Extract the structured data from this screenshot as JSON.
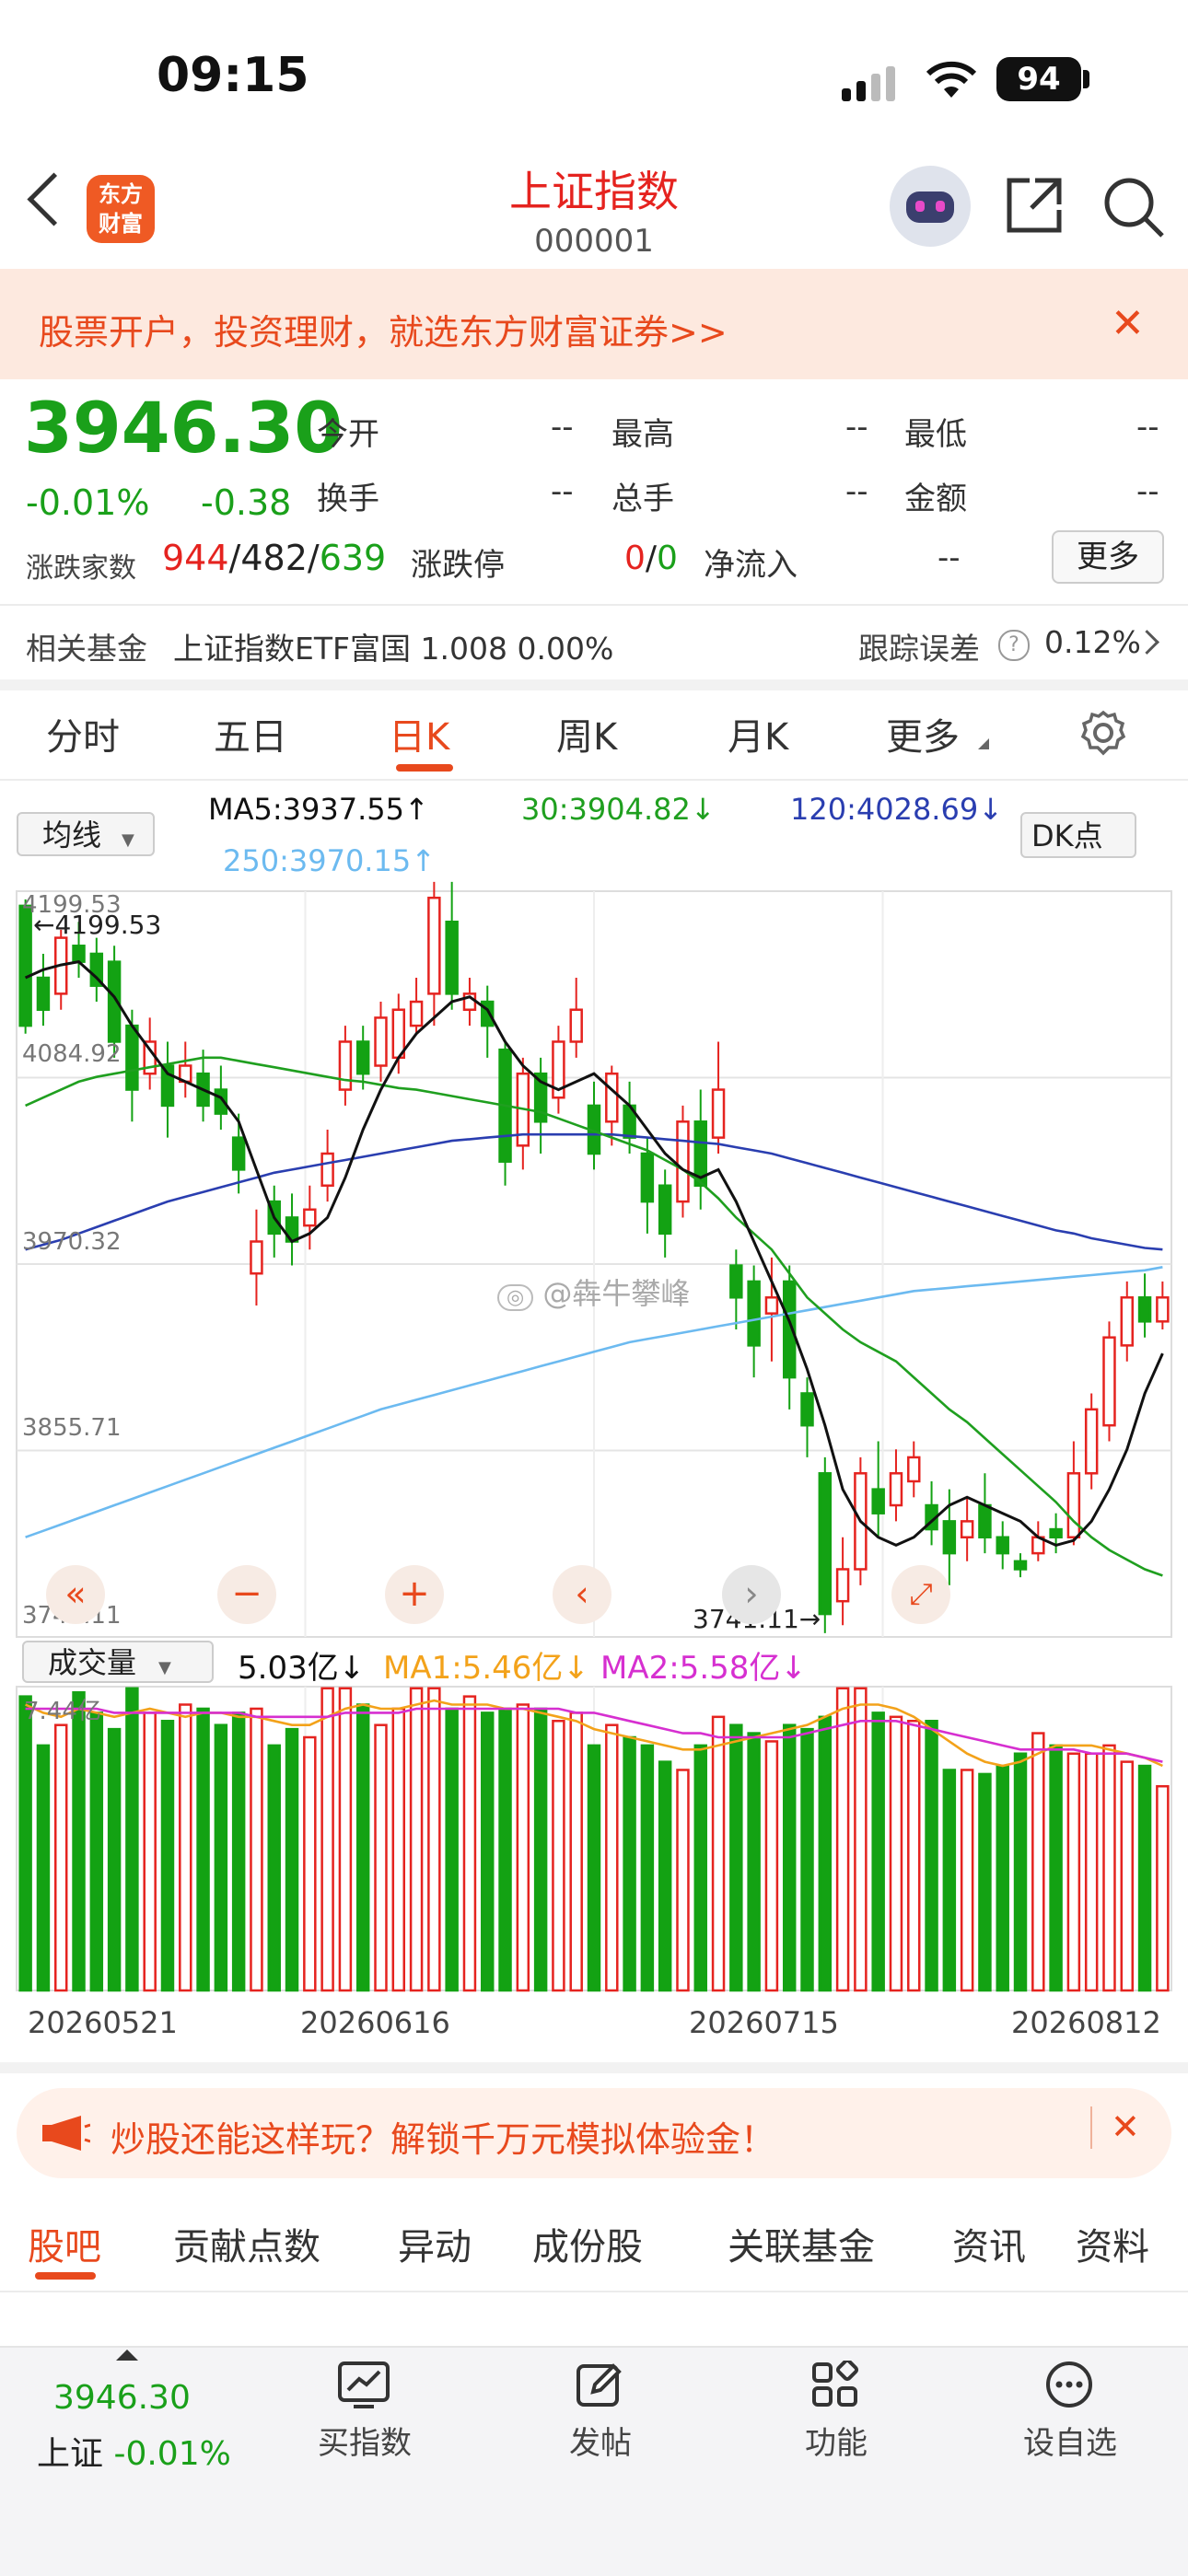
{
  "status_bar": {
    "time": "09:15",
    "battery": "94"
  },
  "header": {
    "title": "上证指数",
    "code": "000001",
    "logo_text_line1": "东方",
    "logo_text_line2": "财富"
  },
  "banner": {
    "text": "股票开户，投资理财，就选东方财富证券>>",
    "close": "✕"
  },
  "quote": {
    "price": "3946.30",
    "change_pct": "-0.01%",
    "change": "-0.38",
    "open_label": "今开",
    "open": "--",
    "high_label": "最高",
    "high": "--",
    "low_label": "最低",
    "low": "--",
    "turnover_label": "换手",
    "turnover": "--",
    "volume_label": "总手",
    "volume": "--",
    "amount_label": "金额",
    "amount": "--",
    "breadth_label": "涨跌家数",
    "breadth_up": "944",
    "breadth_flat": "482",
    "breadth_down": "639",
    "limit_label": "涨跌停",
    "limit_up": "0",
    "limit_down": "0",
    "inflow_label": "净流入",
    "inflow": "--",
    "more": "更多"
  },
  "fund": {
    "label": "相关基金",
    "name": "上证指数ETF富国",
    "price": "1.008",
    "pct": "0.00%",
    "error_label": "跟踪误差",
    "error": "0.12%"
  },
  "tabs": [
    "分时",
    "五日",
    "日K",
    "周K",
    "月K",
    "更多"
  ],
  "active_tab": "日K",
  "chart": {
    "ma_selector": "均线",
    "ma5": "MA5:3937.55↑",
    "ma30": "30:3904.82↓",
    "ma120": "120:4028.69↓",
    "ma250": "250:3970.15↑",
    "dk_button": "DK点",
    "y_labels": [
      "4199.53",
      "4084.92",
      "3970.32",
      "3855.71",
      "3741.11"
    ],
    "max_marker": "4199.53",
    "min_marker": "3741.11",
    "watermark": "@犇牛攀峰",
    "vol_selector": "成交量",
    "vol_value": "5.03亿↓",
    "vol_ma1": "MA1:5.46亿↓",
    "vol_ma2": "MA2:5.58亿↓",
    "vol_max": "7.44亿",
    "x_labels": [
      "20260521",
      "20260616",
      "20260715",
      "20260812"
    ],
    "colors": {
      "up": "#e5231f",
      "down": "#13a213",
      "ma5": "#111111",
      "ma30": "#1f9f1f",
      "ma120": "#2a3eb0",
      "ma250": "#6cbaf0",
      "vma1": "#f3a21a",
      "vma2": "#d62fd0"
    }
  },
  "chart_data": {
    "type": "candlestick",
    "y_range": [
      3741.11,
      4199.53
    ],
    "candles": [
      [
        4195,
        4120,
        4199,
        4115
      ],
      [
        4150,
        4130,
        4165,
        4120
      ],
      [
        4140,
        4175,
        4180,
        4130
      ],
      [
        4170,
        4160,
        4185,
        4150
      ],
      [
        4165,
        4145,
        4175,
        4135
      ],
      [
        4160,
        4110,
        4170,
        4100
      ],
      [
        4120,
        4080,
        4130,
        4060
      ],
      [
        4090,
        4110,
        4125,
        4080
      ],
      [
        4095,
        4070,
        4110,
        4050
      ],
      [
        4085,
        4095,
        4110,
        4075
      ],
      [
        4090,
        4070,
        4105,
        4060
      ],
      [
        4080,
        4065,
        4095,
        4055
      ],
      [
        4050,
        4030,
        4065,
        4015
      ],
      [
        3965,
        3985,
        4005,
        3945
      ],
      [
        4010,
        3990,
        4020,
        3975
      ],
      [
        4000,
        3985,
        4015,
        3970
      ],
      [
        3995,
        4005,
        4020,
        3980
      ],
      [
        4020,
        4040,
        4055,
        4010
      ],
      [
        4080,
        4110,
        4120,
        4070
      ],
      [
        4110,
        4090,
        4120,
        4080
      ],
      [
        4095,
        4125,
        4135,
        4085
      ],
      [
        4100,
        4130,
        4140,
        4090
      ],
      [
        4120,
        4135,
        4150,
        4115
      ],
      [
        4140,
        4200,
        4210,
        4120
      ],
      [
        4185,
        4140,
        4210,
        4130
      ],
      [
        4130,
        4140,
        4150,
        4120
      ],
      [
        4135,
        4120,
        4145,
        4100
      ],
      [
        4105,
        4035,
        4110,
        4020
      ],
      [
        4045,
        4090,
        4100,
        4030
      ],
      [
        4090,
        4060,
        4100,
        4040
      ],
      [
        4075,
        4110,
        4120,
        4065
      ],
      [
        4110,
        4130,
        4150,
        4100
      ],
      [
        4070,
        4040,
        4085,
        4030
      ],
      [
        4060,
        4090,
        4095,
        4045
      ],
      [
        4070,
        4050,
        4085,
        4040
      ],
      [
        4040,
        4010,
        4050,
        3990
      ],
      [
        4020,
        3990,
        4030,
        3975
      ],
      [
        4010,
        4060,
        4070,
        4000
      ],
      [
        4060,
        4020,
        4080,
        4005
      ],
      [
        4050,
        4080,
        4110,
        4040
      ],
      [
        3970,
        3950,
        3980,
        3930
      ],
      [
        3960,
        3920,
        3970,
        3900
      ],
      [
        3940,
        3950,
        3975,
        3910
      ],
      [
        3960,
        3900,
        3970,
        3880
      ],
      [
        3890,
        3870,
        3900,
        3850
      ],
      [
        3840,
        3752,
        3850,
        3740
      ],
      [
        3760,
        3780,
        3800,
        3745
      ],
      [
        3780,
        3840,
        3850,
        3770
      ],
      [
        3830,
        3815,
        3860,
        3800
      ],
      [
        3820,
        3840,
        3855,
        3810
      ],
      [
        3835,
        3850,
        3860,
        3825
      ],
      [
        3820,
        3805,
        3835,
        3795
      ],
      [
        3810,
        3790,
        3830,
        3770
      ],
      [
        3800,
        3810,
        3825,
        3785
      ],
      [
        3820,
        3800,
        3840,
        3790
      ],
      [
        3800,
        3790,
        3810,
        3780
      ],
      [
        3785,
        3780,
        3790,
        3775
      ],
      [
        3790,
        3800,
        3810,
        3785
      ],
      [
        3805,
        3800,
        3815,
        3790
      ],
      [
        3800,
        3840,
        3860,
        3795
      ],
      [
        3840,
        3880,
        3890,
        3830
      ],
      [
        3870,
        3925,
        3935,
        3860
      ],
      [
        3920,
        3950,
        3960,
        3910
      ],
      [
        3950,
        3935,
        3965,
        3925
      ],
      [
        3935,
        3950,
        3960,
        3930
      ]
    ],
    "ma5": [
      4150,
      4155,
      4158,
      4160,
      4150,
      4138,
      4120,
      4105,
      4090,
      4085,
      4080,
      4075,
      4060,
      4030,
      4000,
      3985,
      3990,
      4000,
      4025,
      4055,
      4080,
      4100,
      4115,
      4125,
      4135,
      4138,
      4130,
      4110,
      4095,
      4085,
      4080,
      4085,
      4090,
      4080,
      4070,
      4055,
      4040,
      4030,
      4025,
      4030,
      4010,
      3985,
      3960,
      3935,
      3905,
      3870,
      3830,
      3810,
      3800,
      3795,
      3800,
      3810,
      3820,
      3825,
      3820,
      3815,
      3810,
      3800,
      3795,
      3798,
      3810,
      3830,
      3855,
      3890,
      3915
    ],
    "ma30": [
      4070,
      4075,
      4080,
      4085,
      4088,
      4090,
      4092,
      4094,
      4096,
      4098,
      4100,
      4100,
      4098,
      4096,
      4094,
      4092,
      4090,
      4088,
      4086,
      4085,
      4083,
      4081,
      4080,
      4078,
      4076,
      4074,
      4072,
      4070,
      4068,
      4066,
      4062,
      4058,
      4054,
      4050,
      4046,
      4042,
      4036,
      4030,
      4022,
      4012,
      4000,
      3990,
      3980,
      3965,
      3950,
      3940,
      3930,
      3922,
      3916,
      3910,
      3900,
      3890,
      3880,
      3872,
      3862,
      3852,
      3842,
      3832,
      3822,
      3810,
      3800,
      3792,
      3786,
      3780,
      3776
    ],
    "ma120": [
      3980,
      3983,
      3986,
      3990,
      3994,
      3998,
      4002,
      4006,
      4010,
      4013,
      4016,
      4019,
      4022,
      4025,
      4028,
      4030,
      4032,
      4034,
      4036,
      4038,
      4040,
      4042,
      4044,
      4046,
      4048,
      4049,
      4050,
      4051,
      4052,
      4052,
      4052,
      4052,
      4052,
      4052,
      4051,
      4050,
      4049,
      4048,
      4047,
      4046,
      4044,
      4042,
      4040,
      4037,
      4034,
      4031,
      4028,
      4025,
      4022,
      4019,
      4016,
      4013,
      4010,
      4007,
      4004,
      4001,
      3998,
      3995,
      3992,
      3990,
      3987,
      3985,
      3983,
      3981,
      3980
    ],
    "ma250": [
      3800,
      3804,
      3808,
      3812,
      3816,
      3820,
      3824,
      3828,
      3832,
      3836,
      3840,
      3844,
      3848,
      3852,
      3856,
      3860,
      3864,
      3868,
      3872,
      3876,
      3880,
      3883,
      3886,
      3889,
      3892,
      3895,
      3898,
      3901,
      3904,
      3907,
      3910,
      3913,
      3916,
      3919,
      3922,
      3924,
      3926,
      3928,
      3930,
      3932,
      3934,
      3936,
      3938,
      3940,
      3942,
      3944,
      3946,
      3948,
      3950,
      3952,
      3954,
      3955,
      3956,
      3957,
      3958,
      3959,
      3960,
      3961,
      3962,
      3963,
      3964,
      3965,
      3966,
      3967,
      3969
    ],
    "volume_max": 7.44,
    "volumes": [
      7.2,
      6.0,
      6.5,
      7.3,
      6.8,
      6.4,
      7.4,
      6.8,
      6.6,
      7.0,
      6.9,
      6.5,
      6.8,
      6.9,
      6.0,
      6.4,
      6.2,
      7.4,
      7.4,
      7.0,
      6.5,
      6.9,
      7.4,
      7.4,
      6.9,
      7.2,
      6.8,
      6.9,
      7.0,
      6.9,
      6.6,
      6.8,
      6.0,
      6.5,
      6.2,
      6.0,
      5.6,
      5.4,
      6.0,
      6.7,
      6.5,
      6.3,
      6.1,
      6.5,
      6.4,
      6.7,
      7.4,
      7.4,
      6.8,
      6.7,
      6.6,
      6.6,
      5.4,
      5.4,
      5.3,
      5.5,
      5.8,
      6.3,
      6.0,
      5.8,
      5.8,
      6.0,
      5.6,
      5.5,
      5.0
    ],
    "vma1": [
      7.0,
      6.8,
      6.7,
      6.9,
      6.8,
      6.7,
      6.8,
      6.9,
      6.8,
      6.7,
      6.8,
      6.8,
      6.7,
      6.7,
      6.6,
      6.5,
      6.5,
      6.7,
      6.9,
      7.0,
      6.9,
      6.9,
      7.0,
      7.1,
      7.0,
      7.0,
      7.0,
      6.9,
      6.9,
      6.8,
      6.7,
      6.6,
      6.4,
      6.3,
      6.2,
      6.1,
      6.0,
      5.9,
      5.9,
      6.0,
      6.1,
      6.2,
      6.3,
      6.4,
      6.5,
      6.7,
      6.9,
      7.0,
      7.0,
      6.9,
      6.7,
      6.4,
      6.1,
      5.8,
      5.6,
      5.5,
      5.6,
      5.8,
      6.0,
      6.0,
      6.0,
      5.9,
      5.8,
      5.7,
      5.5
    ],
    "vma2": [
      6.9,
      6.9,
      6.9,
      6.9,
      6.9,
      6.8,
      6.8,
      6.8,
      6.8,
      6.8,
      6.8,
      6.8,
      6.8,
      6.7,
      6.7,
      6.7,
      6.7,
      6.7,
      6.8,
      6.8,
      6.8,
      6.8,
      6.9,
      6.9,
      6.9,
      6.9,
      6.9,
      6.9,
      6.9,
      6.9,
      6.9,
      6.8,
      6.8,
      6.7,
      6.6,
      6.5,
      6.4,
      6.3,
      6.3,
      6.2,
      6.2,
      6.2,
      6.2,
      6.2,
      6.3,
      6.4,
      6.5,
      6.6,
      6.6,
      6.6,
      6.5,
      6.4,
      6.3,
      6.2,
      6.1,
      6.0,
      5.9,
      5.9,
      5.9,
      5.9,
      5.8,
      5.8,
      5.8,
      5.7,
      5.6
    ],
    "x_labels": [
      "20260521",
      "20260616",
      "20260715",
      "20260812"
    ]
  },
  "promo": {
    "text": "炒股还能这样玩？解锁千万元模拟体验金！"
  },
  "bottom_tabs": [
    "股吧",
    "贡献点数",
    "异动",
    "成份股",
    "关联基金",
    "资讯",
    "资料"
  ],
  "bottom_bar": {
    "mini_price": "3946.30",
    "mini_name": "上证",
    "mini_pct": "-0.01%",
    "buttons": [
      "买指数",
      "发帖",
      "功能",
      "设自选"
    ]
  }
}
